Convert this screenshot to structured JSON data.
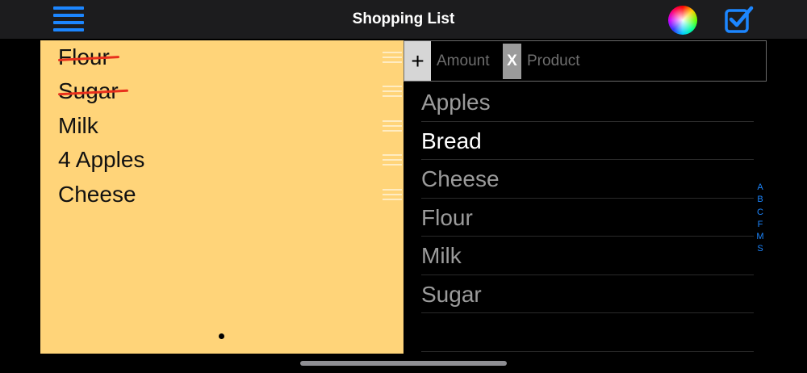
{
  "header": {
    "title": "Shopping List"
  },
  "icons": {
    "menu": "hamburger-menu-icon",
    "color": "color-wheel-icon",
    "check": "checkbox-checked-icon"
  },
  "colors": {
    "accent": "#1c86ff",
    "note_background": "#ffd479",
    "strike": "#e8301c"
  },
  "list": {
    "items": [
      {
        "label": "Flour",
        "done": true
      },
      {
        "label": "Sugar",
        "done": true
      },
      {
        "label": "Milk",
        "done": false
      },
      {
        "label": "4 Apples",
        "done": false
      },
      {
        "label": "Cheese",
        "done": false
      }
    ]
  },
  "input": {
    "add_label": "+",
    "amount_placeholder": "Amount",
    "clear_label": "X",
    "product_placeholder": "Product"
  },
  "products": {
    "items": [
      "Apples",
      "Bread",
      "Cheese",
      "Flour",
      "Milk",
      "Sugar"
    ],
    "active": "Bread"
  },
  "index": {
    "letters": [
      "A",
      "B",
      "C",
      "F",
      "M",
      "S"
    ]
  }
}
